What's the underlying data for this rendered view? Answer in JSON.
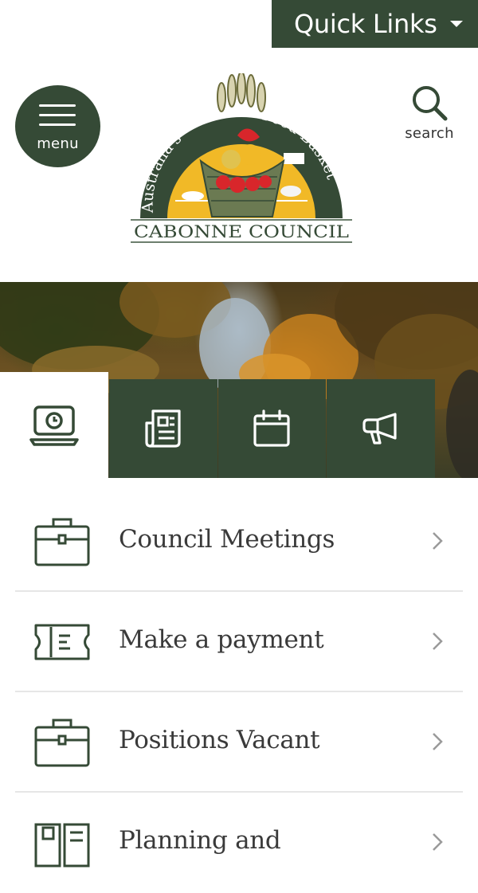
{
  "quick_links": {
    "label": "Quick Links",
    "icon": "caret-down-icon"
  },
  "header": {
    "menu_label": "menu",
    "search_label": "search",
    "logo": {
      "arc_text_left": "Australia's",
      "arc_text_right": "Food Basket",
      "name": "CABONNE COUNCIL"
    }
  },
  "tabs": [
    {
      "icon": "laptop-clock-icon",
      "active": true
    },
    {
      "icon": "newspaper-icon",
      "active": false
    },
    {
      "icon": "calendar-icon",
      "active": false
    },
    {
      "icon": "megaphone-icon",
      "active": false
    }
  ],
  "links": [
    {
      "label": "Council Meetings",
      "icon": "briefcase-icon"
    },
    {
      "label": "Make a payment",
      "icon": "ticket-icon"
    },
    {
      "label": "Positions Vacant",
      "icon": "briefcase-icon"
    },
    {
      "label": "Planning and",
      "icon": "planning-document-icon"
    }
  ],
  "colors": {
    "primary": "#354a36",
    "text": "#3a3a3a",
    "divider": "#e6e6e6",
    "logo_gold": "#f1b927",
    "logo_red": "#d8262b"
  }
}
